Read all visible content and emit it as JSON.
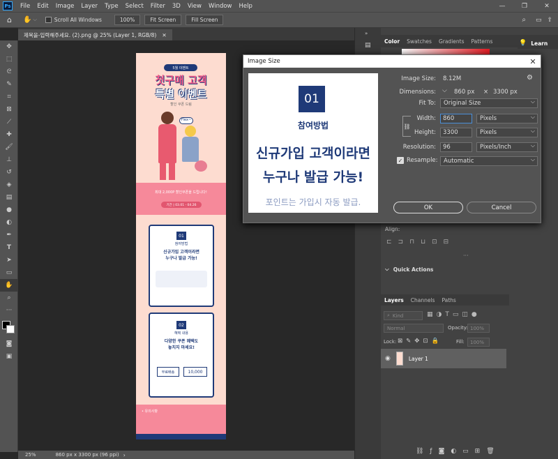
{
  "menubar": {
    "items": [
      "File",
      "Edit",
      "Image",
      "Layer",
      "Type",
      "Select",
      "Filter",
      "3D",
      "View",
      "Window",
      "Help"
    ]
  },
  "options": {
    "scroll_all": "Scroll All Windows",
    "zoom": "100%",
    "fit": "Fit Screen",
    "fill": "Fill Screen"
  },
  "doc_tab": {
    "title": "제목을-입력해주세요. (2).png @ 25% (Layer 1, RGB/8)"
  },
  "status": {
    "zoom": "25%",
    "info": "860 px x 3300 px (96 ppi)"
  },
  "panels": {
    "top_tabs": [
      "Color",
      "Swatches",
      "Gradients",
      "Patterns"
    ],
    "learn": "Learn",
    "align_label": "Align:",
    "quick_actions": "Quick Actions",
    "layers_tabs": [
      "Layers",
      "Channels",
      "Paths"
    ],
    "kind": "Kind",
    "blend": "Normal",
    "opacity_label": "Opacity:",
    "opacity": "100%",
    "lock_label": "Lock:",
    "fill_label": "Fill:",
    "fill": "100%",
    "layer_name": "Layer 1"
  },
  "dialog": {
    "title": "Image Size",
    "image_size_label": "Image Size:",
    "image_size": "8.12M",
    "dimensions_label": "Dimensions:",
    "dimensions_w": "860 px",
    "dimensions_x": "×",
    "dimensions_h": "3300 px",
    "fit_to_label": "Fit To:",
    "fit_to": "Original Size",
    "width_label": "Width:",
    "width": "860",
    "width_unit": "Pixels",
    "height_label": "Height:",
    "height": "3300",
    "height_unit": "Pixels",
    "resolution_label": "Resolution:",
    "resolution": "96",
    "resolution_unit": "Pixels/Inch",
    "resample_label": "Resample:",
    "resample": "Automatic",
    "ok": "OK",
    "cancel": "Cancel",
    "preview": {
      "badge": "01",
      "subtitle": "참여방법",
      "line1": "신규가입 고객이라면",
      "line2": "누구나 발급 가능!",
      "footer": "포인트는 가입시 자동 발급."
    }
  },
  "poster": {
    "tag": "5월 이벤트",
    "title1": "첫구매 고객",
    "title2": "특별 이벤트",
    "sub": "할인 쿠폰 드림",
    "pink_text": "최대 2,000P 할인쿠폰을 드립니다!",
    "period": "기간 | 03.01 - 04.26",
    "card1": {
      "badge": "01",
      "title": "참여방법",
      "l1": "신규가입 고객이라면",
      "l2": "누구나 발급 가능!"
    },
    "card2": {
      "badge": "02",
      "title": "혜택 내용",
      "l1": "다양한 쿠폰 혜택도",
      "l2": "놓치지 마세요!",
      "c1": "무료배송",
      "c2": "10,000"
    },
    "notice": "• 유의사항"
  },
  "colors": {
    "accent": "#1f3a78",
    "pink": "#f6899a",
    "peach": "#fddcd0"
  }
}
